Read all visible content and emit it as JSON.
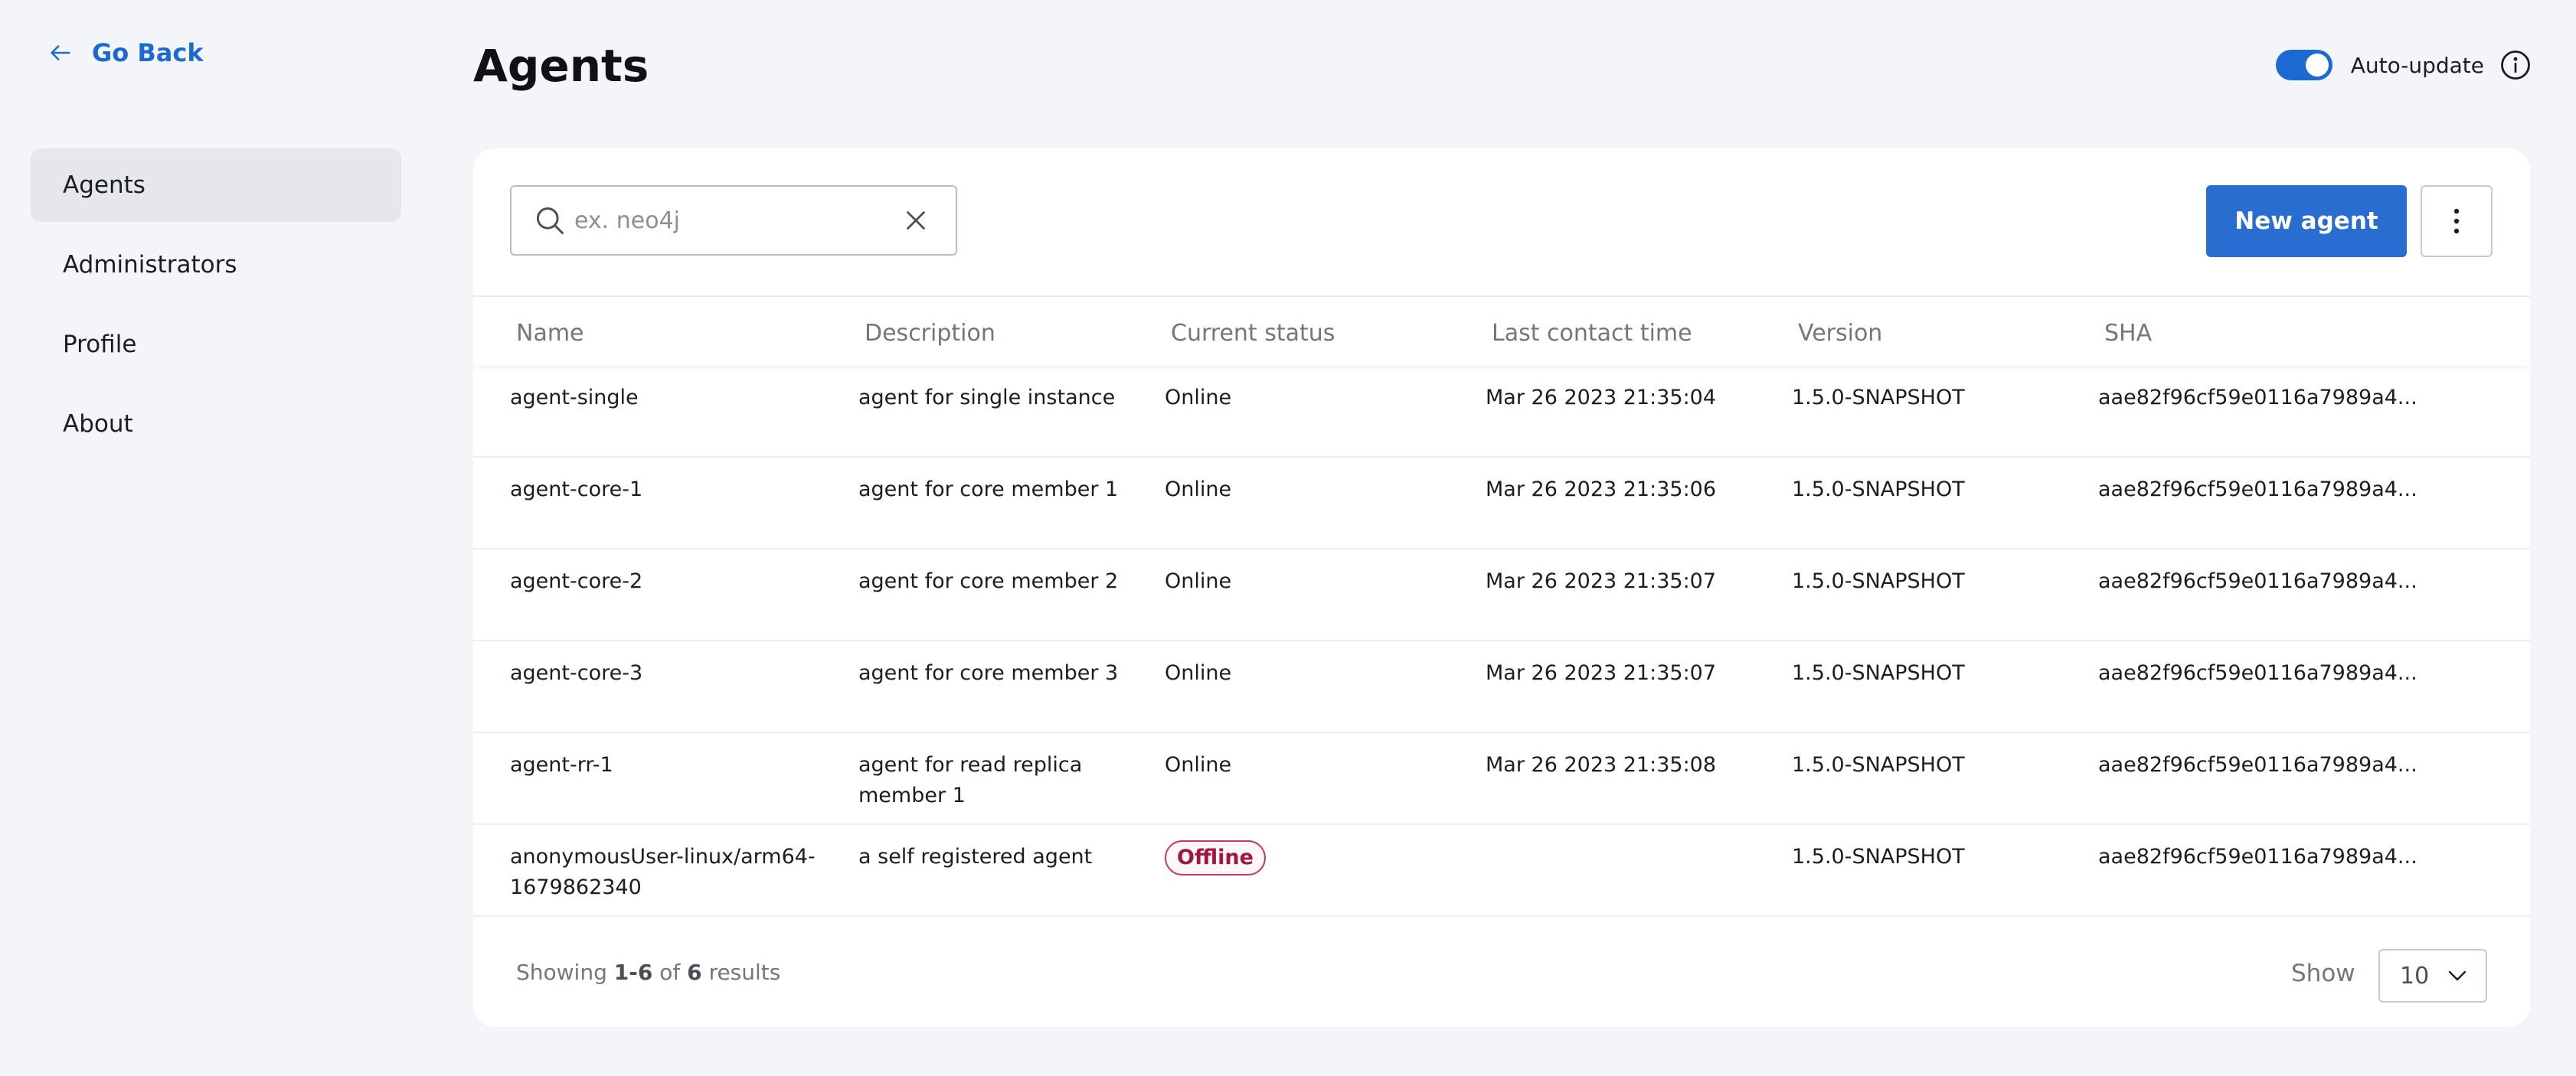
{
  "nav": {
    "go_back": "Go Back"
  },
  "sidebar": {
    "items": [
      {
        "label": "Agents",
        "active": true
      },
      {
        "label": "Administrators"
      },
      {
        "label": "Profile"
      },
      {
        "label": "About"
      }
    ]
  },
  "header": {
    "title": "Agents",
    "auto_update_label": "Auto-update",
    "auto_update_on": true
  },
  "toolbar": {
    "search_placeholder": "ex. neo4j",
    "search_value": "",
    "new_agent_label": "New agent"
  },
  "table": {
    "columns": [
      "Name",
      "Description",
      "Current status",
      "Last contact time",
      "Version",
      "SHA"
    ],
    "rows": [
      {
        "name": "agent-single",
        "description": "agent for single instance",
        "status": "Online",
        "last_contact": "Mar 26 2023 21:35:04",
        "version": "1.5.0-SNAPSHOT",
        "sha": "aae82f96cf59e0116a7989a4..."
      },
      {
        "name": "agent-core-1",
        "description": "agent for core member 1",
        "status": "Online",
        "last_contact": "Mar 26 2023 21:35:06",
        "version": "1.5.0-SNAPSHOT",
        "sha": "aae82f96cf59e0116a7989a4..."
      },
      {
        "name": "agent-core-2",
        "description": "agent for core member 2",
        "status": "Online",
        "last_contact": "Mar 26 2023 21:35:07",
        "version": "1.5.0-SNAPSHOT",
        "sha": "aae82f96cf59e0116a7989a4..."
      },
      {
        "name": "agent-core-3",
        "description": "agent for core member 3",
        "status": "Online",
        "last_contact": "Mar 26 2023 21:35:07",
        "version": "1.5.0-SNAPSHOT",
        "sha": "aae82f96cf59e0116a7989a4..."
      },
      {
        "name": "agent-rr-1",
        "description": "agent for read replica member 1",
        "status": "Online",
        "last_contact": "Mar 26 2023 21:35:08",
        "version": "1.5.0-SNAPSHOT",
        "sha": "aae82f96cf59e0116a7989a4..."
      },
      {
        "name": "anonymousUser-linux/arm64-1679862340",
        "description": "a self registered agent",
        "status": "Offline",
        "last_contact": "",
        "version": "1.5.0-SNAPSHOT",
        "sha": "aae82f96cf59e0116a7989a4..."
      }
    ]
  },
  "footer": {
    "showing_prefix": "Showing",
    "range": "1-6",
    "of_label": "of",
    "total": "6",
    "results_label": "results",
    "show_label": "Show",
    "page_size": "10"
  },
  "colors": {
    "accent": "#2a6dd1",
    "link": "#1b6ad1",
    "offline": "#a3153e",
    "background": "#f4f5f8"
  }
}
